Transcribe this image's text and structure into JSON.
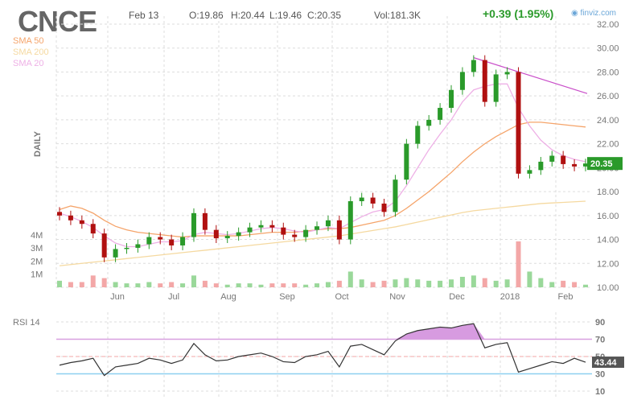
{
  "header": {
    "ticker": "CNCE",
    "date": "Feb 13",
    "open": "O:19.86",
    "high": "H:20.44",
    "low": "L:19.46",
    "close": "C:20.35",
    "volume": "Vol:181.3K",
    "change": "+0.39 (1.95%)",
    "brand": "finviz.com"
  },
  "legend": [
    {
      "label": "SMA 50",
      "color": "#f5a46a"
    },
    {
      "label": "SMA 200",
      "color": "#f5d9a0"
    },
    {
      "label": "SMA 20",
      "color": "#eeb0e6"
    }
  ],
  "chart_data": {
    "type": "candlestick",
    "period": "DAILY",
    "price_ticks": [
      "32.00",
      "30.00",
      "28.00",
      "26.00",
      "24.00",
      "22.00",
      "20.00",
      "18.00",
      "16.00",
      "14.00",
      "12.00",
      "10.00"
    ],
    "price_range": [
      10,
      32
    ],
    "volume_ticks": [
      "4M",
      "3M",
      "2M",
      "1M"
    ],
    "x_labels": [
      "Jun",
      "Jul",
      "Aug",
      "Sep",
      "Oct",
      "Nov",
      "Dec",
      "2018",
      "Feb"
    ],
    "last_price": "20.35",
    "closes": [
      16.0,
      15.6,
      15.3,
      14.5,
      12.5,
      13.2,
      13.3,
      13.6,
      14.2,
      14.0,
      13.5,
      14.2,
      16.2,
      14.8,
      14.1,
      14.3,
      14.6,
      15.0,
      15.2,
      15.0,
      14.4,
      14.2,
      14.8,
      15.1,
      15.6,
      14.0,
      17.2,
      17.5,
      17.0,
      16.3,
      19.0,
      22.0,
      23.5,
      24.0,
      25.0,
      26.5,
      28.0,
      29.0,
      25.5,
      27.8,
      28.0,
      19.5,
      19.8,
      20.5,
      21.0,
      20.3,
      20.1,
      20.35
    ],
    "sma50": [
      16.5,
      16.8,
      16.6,
      16.2,
      15.6,
      15.1,
      14.8,
      14.6,
      14.5,
      14.4,
      14.3,
      14.2,
      14.3,
      14.3,
      14.3,
      14.3,
      14.3,
      14.4,
      14.5,
      14.6,
      14.6,
      14.6,
      14.7,
      14.8,
      14.9,
      14.9,
      15.0,
      15.2,
      15.4,
      15.6,
      16.0,
      16.6,
      17.3,
      18.0,
      18.8,
      19.6,
      20.5,
      21.3,
      22.0,
      22.6,
      23.1,
      23.6,
      23.8,
      23.8,
      23.7,
      23.6,
      23.5,
      23.4
    ],
    "sma200": [
      11.8,
      11.9,
      12.0,
      12.1,
      12.2,
      12.3,
      12.4,
      12.5,
      12.6,
      12.7,
      12.8,
      12.9,
      13.0,
      13.1,
      13.2,
      13.3,
      13.4,
      13.5,
      13.6,
      13.7,
      13.8,
      13.9,
      14.0,
      14.1,
      14.2,
      14.3,
      14.45,
      14.6,
      14.75,
      14.9,
      15.05,
      15.25,
      15.45,
      15.65,
      15.85,
      16.05,
      16.25,
      16.4,
      16.5,
      16.6,
      16.7,
      16.8,
      16.9,
      17.0,
      17.05,
      17.1,
      17.15,
      17.2
    ],
    "sma20": [
      16.2,
      15.9,
      15.5,
      15.0,
      14.3,
      13.7,
      13.4,
      13.4,
      13.6,
      13.8,
      13.8,
      13.9,
      14.4,
      14.6,
      14.5,
      14.4,
      14.5,
      14.7,
      14.9,
      15.0,
      14.9,
      14.7,
      14.6,
      14.8,
      15.0,
      14.9,
      15.4,
      15.9,
      16.3,
      16.5,
      17.2,
      18.5,
      20.0,
      21.5,
      22.8,
      24.0,
      25.5,
      26.5,
      26.8,
      27.0,
      27.0,
      25.0,
      23.5,
      22.3,
      21.5,
      21.0,
      20.7,
      20.5
    ],
    "volume_m": [
      0.5,
      0.4,
      0.4,
      0.9,
      0.7,
      0.4,
      0.3,
      0.3,
      0.4,
      0.3,
      0.4,
      0.3,
      0.9,
      0.5,
      0.3,
      0.2,
      0.3,
      0.3,
      0.2,
      0.3,
      0.3,
      0.3,
      0.2,
      0.3,
      0.4,
      0.5,
      1.2,
      0.6,
      0.4,
      0.5,
      0.6,
      0.7,
      0.6,
      0.5,
      0.5,
      0.6,
      0.8,
      0.9,
      0.7,
      0.5,
      0.6,
      3.5,
      1.2,
      0.7,
      0.4,
      0.5,
      0.4,
      0.2
    ],
    "trendline": {
      "from": [
        29.2
      ],
      "to": [
        26.2
      ]
    },
    "rsi": {
      "label": "RSI 14",
      "ticks": [
        "90",
        "70",
        "50",
        "30",
        "10"
      ],
      "overbought": 70,
      "oversold": 30,
      "last": "43.44",
      "values": [
        40,
        43,
        45,
        48,
        28,
        38,
        40,
        42,
        48,
        46,
        42,
        46,
        65,
        52,
        45,
        46,
        50,
        52,
        54,
        50,
        44,
        43,
        50,
        52,
        56,
        38,
        62,
        64,
        58,
        52,
        68,
        76,
        80,
        82,
        84,
        83,
        86,
        88,
        60,
        64,
        66,
        32,
        36,
        40,
        44,
        42,
        48,
        43.44
      ]
    }
  }
}
